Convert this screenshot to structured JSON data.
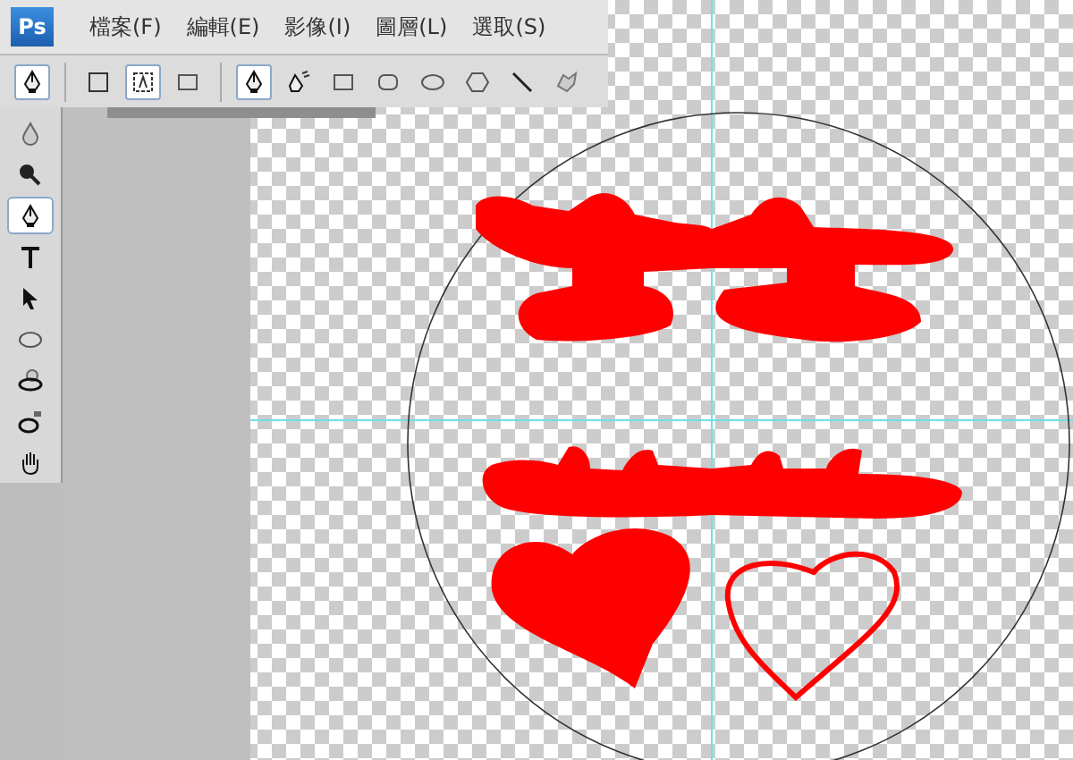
{
  "app_logo": "Ps",
  "menu": [
    {
      "label": "檔案(F)"
    },
    {
      "label": "編輯(E)"
    },
    {
      "label": "影像(I)"
    },
    {
      "label": "圖層(L)"
    },
    {
      "label": "選取(S)"
    }
  ],
  "options_bar": {
    "modes": [
      {
        "kind": "shape-layers",
        "selected": false
      },
      {
        "kind": "paths",
        "selected": true
      },
      {
        "kind": "fill-pixels",
        "selected": false
      }
    ],
    "tools": [
      {
        "kind": "pen",
        "selected": true
      },
      {
        "kind": "freeform-pen",
        "selected": false
      },
      {
        "kind": "rectangle",
        "selected": false
      },
      {
        "kind": "rounded-rectangle",
        "selected": false
      },
      {
        "kind": "ellipse",
        "selected": false
      },
      {
        "kind": "polygon",
        "selected": false
      },
      {
        "kind": "line",
        "selected": false
      },
      {
        "kind": "custom-shape",
        "selected": false
      }
    ]
  },
  "toolbox": [
    {
      "kind": "drop",
      "selected": false
    },
    {
      "kind": "burn",
      "selected": false
    },
    {
      "kind": "pen",
      "selected": true
    },
    {
      "kind": "type",
      "selected": false
    },
    {
      "kind": "arrow",
      "selected": false
    },
    {
      "kind": "ellipse",
      "selected": false
    },
    {
      "kind": "rotate-3d",
      "selected": false
    },
    {
      "kind": "orbit-3d",
      "selected": false
    },
    {
      "kind": "hand",
      "selected": false
    }
  ]
}
